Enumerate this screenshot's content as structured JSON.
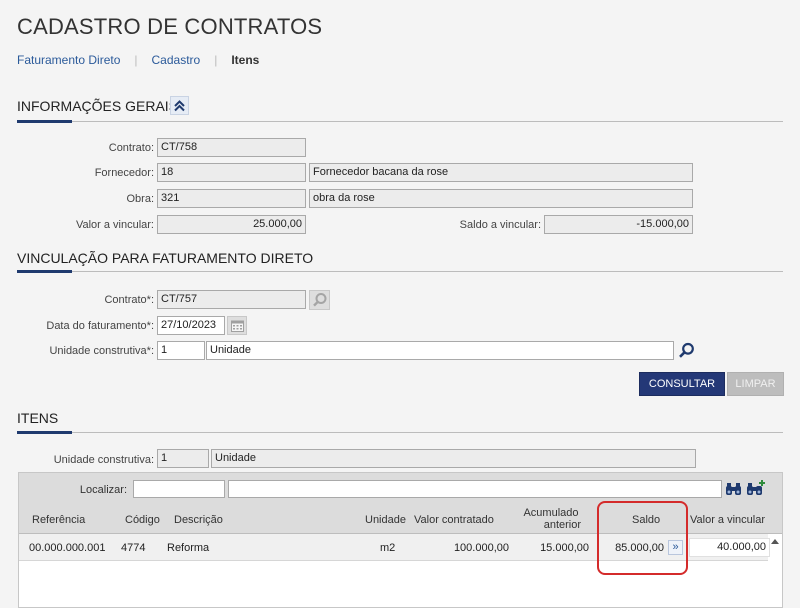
{
  "page": {
    "title": "CADASTRO DE CONTRATOS"
  },
  "breadcrumb": [
    "Faturamento Direto",
    "Cadastro",
    "Itens"
  ],
  "info": {
    "title": "INFORMAÇÕES GERAIS",
    "contrato_label": "Contrato:",
    "contrato_value": "CT/758",
    "fornecedor_label": "Fornecedor:",
    "fornecedor_code": "18",
    "fornecedor_name": "Fornecedor bacana da rose",
    "obra_label": "Obra:",
    "obra_code": "321",
    "obra_name": "obra da rose",
    "valor_label": "Valor a vincular:",
    "valor_value": "25.000,00",
    "saldo_label": "Saldo a vincular:",
    "saldo_value": "-15.000,00"
  },
  "vinc": {
    "title": "VINCULAÇÃO PARA FATURAMENTO DIRETO",
    "contrato_label": "Contrato*:",
    "contrato_value": "CT/757",
    "data_label": "Data do faturamento*:",
    "data_value": "27/10/2023",
    "unidade_label": "Unidade construtiva*:",
    "unidade_code": "1",
    "unidade_name": "Unidade",
    "consultar": "CONSULTAR",
    "limpar": "LIMPAR"
  },
  "itens": {
    "title": "ITENS",
    "unidade_label": "Unidade construtiva:",
    "unidade_code": "1",
    "unidade_name": "Unidade",
    "localizar_label": "Localizar:",
    "localizar_value1": "",
    "localizar_value2": "",
    "columns": {
      "referencia": "Referência",
      "codigo": "Código",
      "descricao": "Descrição",
      "unidade": "Unidade",
      "valor_contratado": "Valor contratado",
      "acumulado_1": "Acumulado",
      "acumulado_2": "anterior",
      "saldo": "Saldo",
      "valor_vincular": "Valor a vincular"
    },
    "rows": [
      {
        "referencia": "00.000.000.001",
        "codigo": "4774",
        "descricao": "Reforma",
        "unidade": "m2",
        "valor_contratado": "100.000,00",
        "acumulado": "15.000,00",
        "saldo": "85.000,00",
        "transfer": "»",
        "valor_vincular": "40.000,00"
      }
    ]
  },
  "colors": {
    "accent": "#1f3a6e",
    "primary_button": "#243877",
    "link": "#2b5a9a",
    "highlight": "#d42b2b"
  }
}
